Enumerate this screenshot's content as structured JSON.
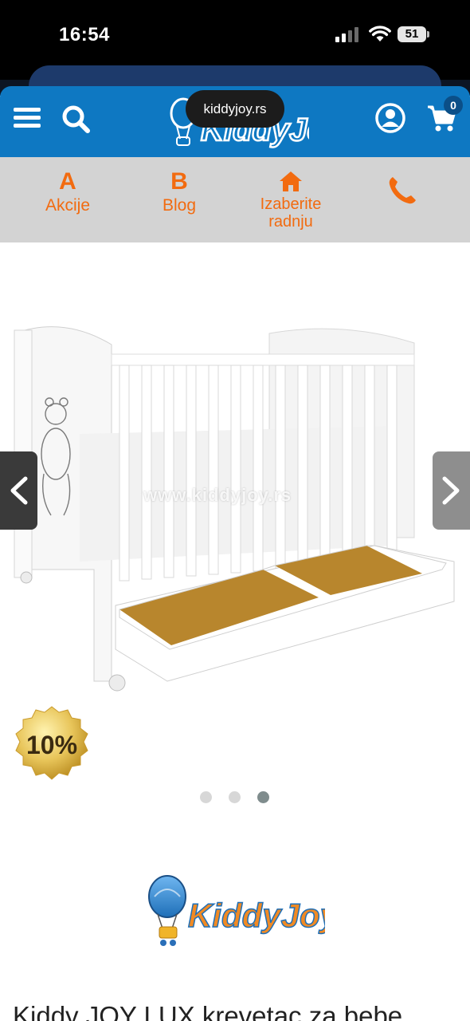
{
  "status_bar": {
    "time": "16:54",
    "battery_level": "51"
  },
  "browser": {
    "url": "kiddyjoy.rs"
  },
  "header": {
    "logo_text": "KiddyJoy",
    "cart_count": "0",
    "icons": [
      "menu-icon",
      "search-icon",
      "user-icon",
      "cart-icon"
    ],
    "background_color": "#0e78c2"
  },
  "quick_nav": {
    "accent_color": "#f26b10",
    "items": [
      {
        "letter": "A",
        "label": "Akcije"
      },
      {
        "letter": "B",
        "label": "Blog"
      },
      {
        "icon": "home-icon",
        "label_line1": "Izaberite",
        "label_line2": "radnju"
      },
      {
        "icon": "phone-icon"
      }
    ]
  },
  "gallery": {
    "watermark": "www.kiddyjoy.rs",
    "discount_badge": "10%",
    "slide_count": 3,
    "active_slide": 3,
    "image_subject": "white-baby-crib-with-drawer"
  },
  "brand": {
    "logo_text": "KiddyJoy"
  },
  "product": {
    "title": "Kiddy JOY LUX krevetac za bebe"
  }
}
